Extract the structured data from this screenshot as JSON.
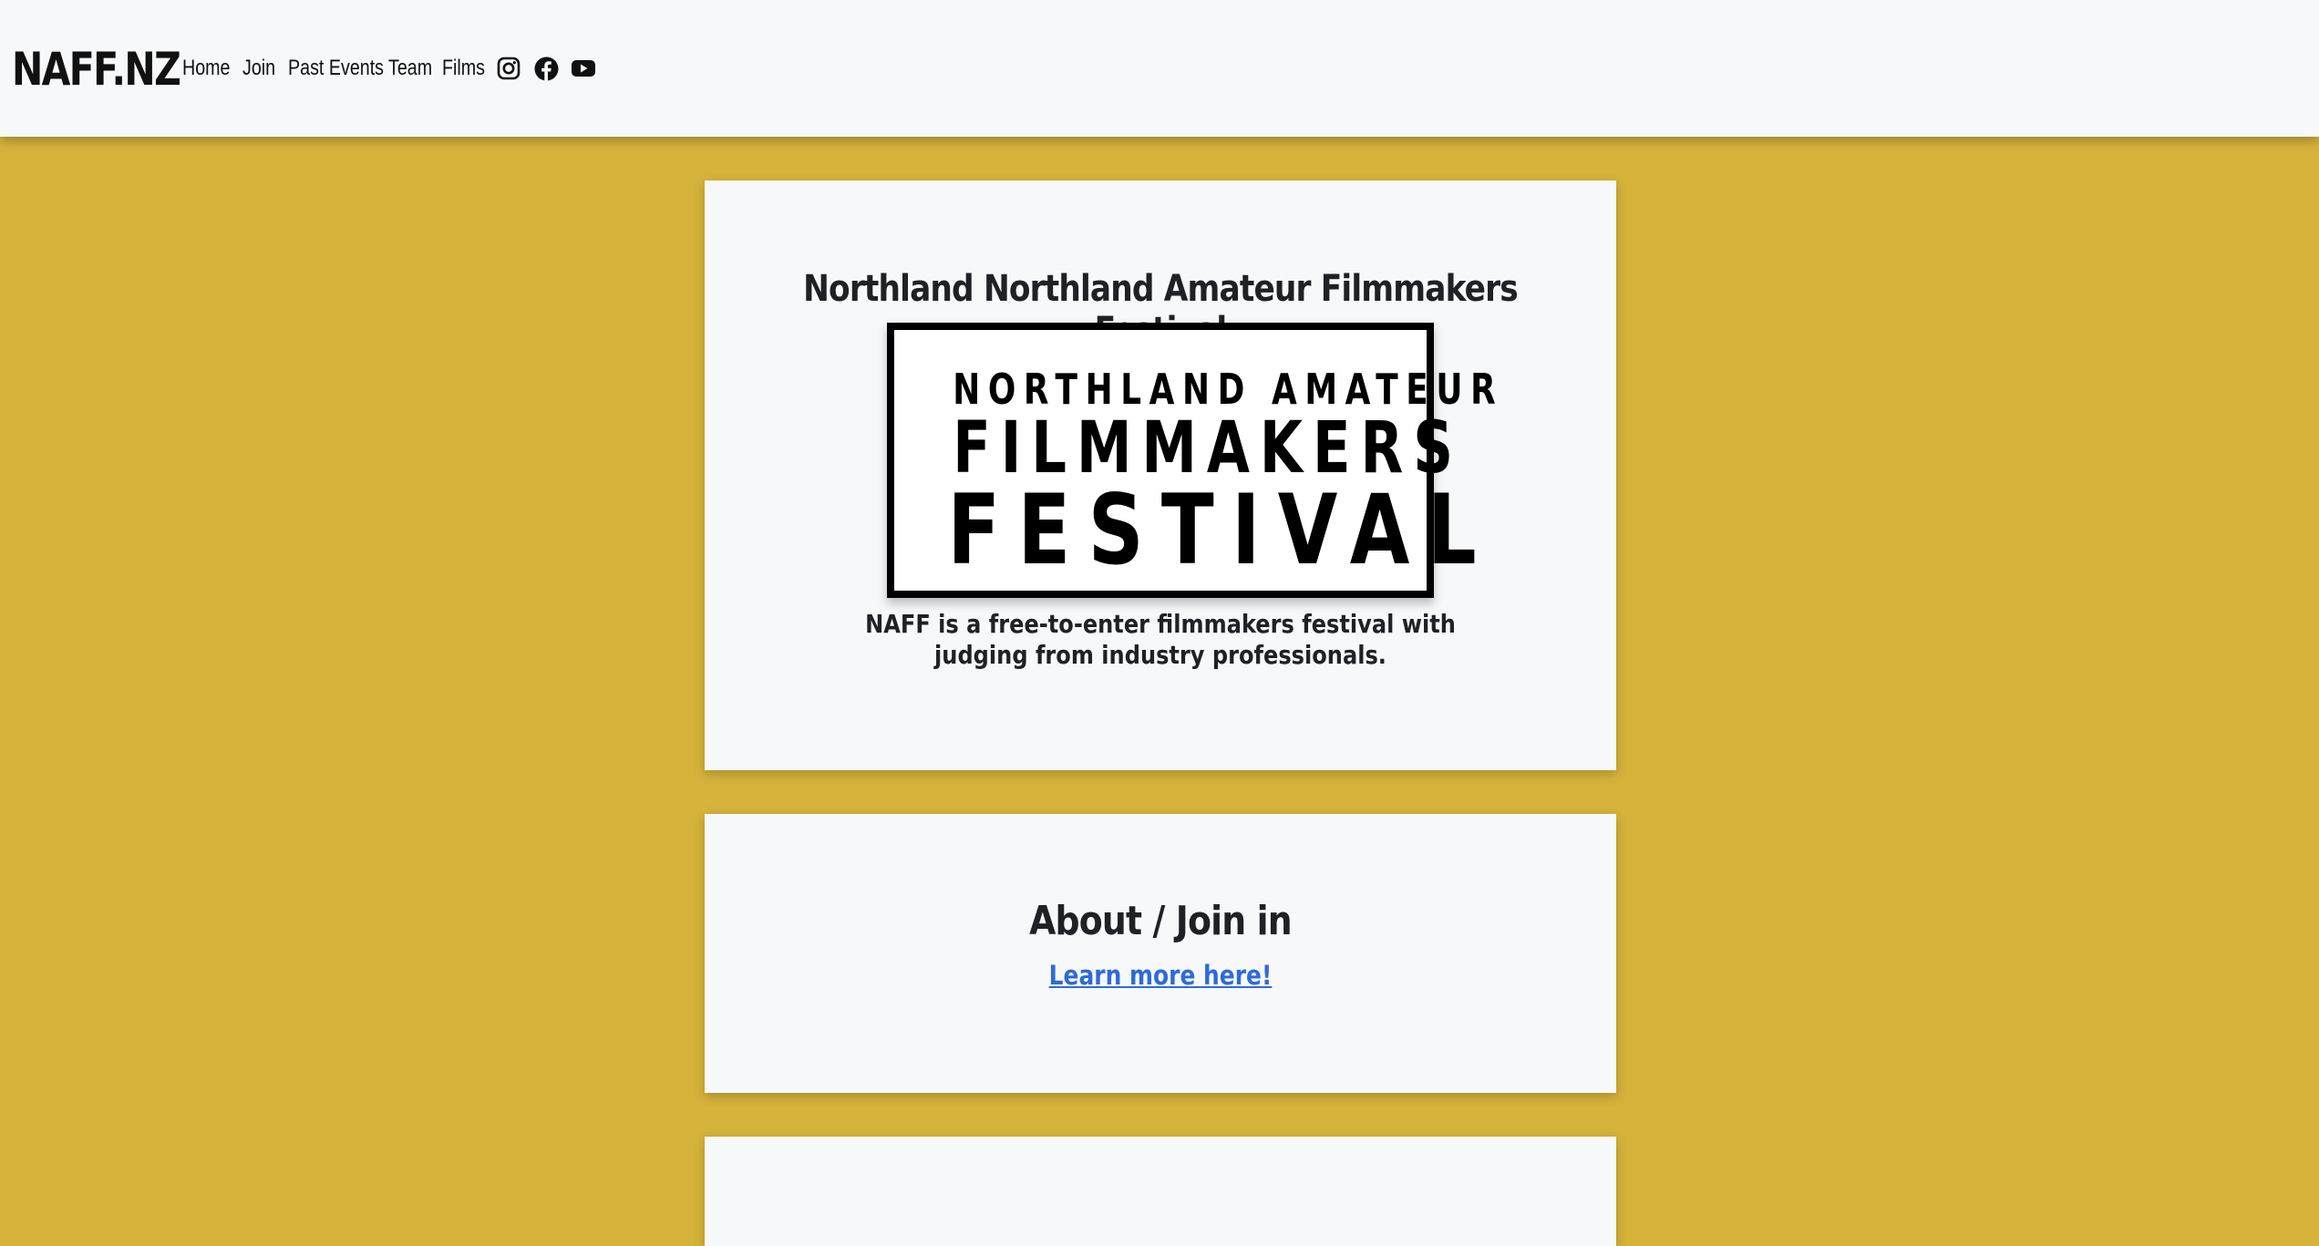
{
  "header": {
    "brand": "NAFF.NZ",
    "nav": [
      {
        "label": "Home"
      },
      {
        "label": "Join"
      },
      {
        "label": "Past Events"
      },
      {
        "label": "Team"
      },
      {
        "label": "Films"
      }
    ],
    "social_icons": [
      "instagram-icon",
      "facebook-icon",
      "youtube-icon"
    ]
  },
  "hero": {
    "title": "Northland Northland Amateur Filmmakers Festival",
    "logo_text": {
      "line1": "NORTHLAND AMATEUR",
      "line2": "FILMMAKERS",
      "line3": "FESTIVAL"
    },
    "description": "NAFF is a free-to-enter filmmakers festival with judging from industry professionals."
  },
  "about": {
    "title": "About / Join in",
    "link": "Learn more here!"
  },
  "colors": {
    "page_background": "#d6b33b",
    "card_background": "#f7f8fa",
    "link": "#2f6ad9",
    "text": "#1f2126"
  }
}
